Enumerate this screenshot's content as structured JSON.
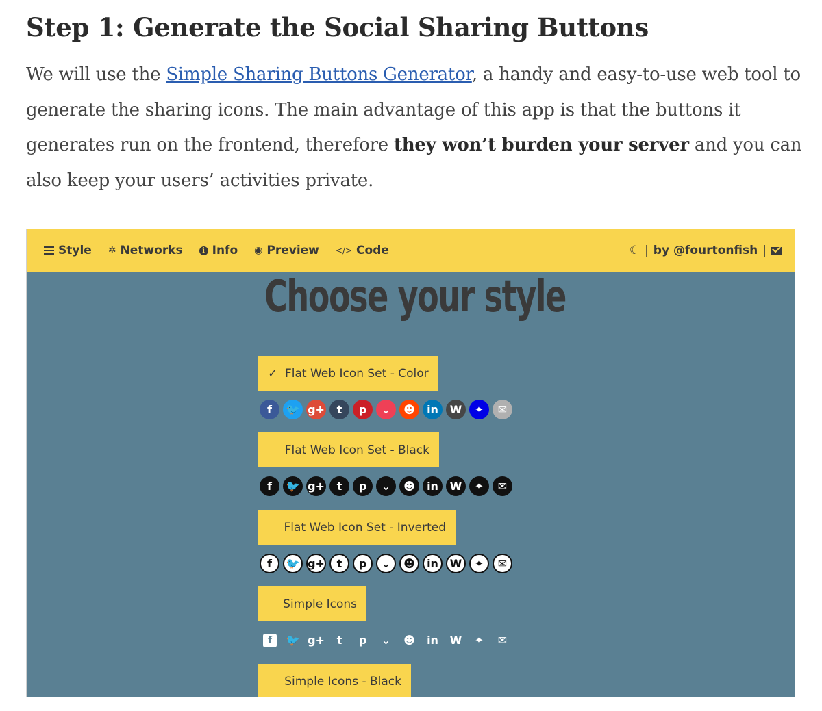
{
  "article": {
    "heading": "Step 1: Generate the Social Sharing Buttons",
    "p_before_link": "We will use the ",
    "link_text": "Simple Sharing Buttons Generator",
    "p_after_link": ", a handy and easy-to-use web tool to generate the sharing icons. The main advantage of this app is that the buttons it generates run on the frontend, therefore ",
    "p_bold": "they won’t burden your server",
    "p_end": " and you can also keep your users’ activities private."
  },
  "app": {
    "nav": [
      {
        "label": "Style",
        "icon": "list-icon"
      },
      {
        "label": "Networks",
        "icon": "gear-icon"
      },
      {
        "label": "Info",
        "icon": "info-icon"
      },
      {
        "label": "Preview",
        "icon": "eye-icon"
      },
      {
        "label": "Code",
        "icon": "code-icon"
      }
    ],
    "right_nav": {
      "moon_glyph": "☾",
      "separator": "|",
      "by_label": "by @fourtonfish",
      "icon": "mail-icon"
    },
    "title": "Choose your style",
    "style_options": [
      {
        "label": "Flat Web Icon Set - Color",
        "selected": true,
        "check": "✓"
      },
      {
        "label": "Flat Web Icon Set - Black",
        "selected": false,
        "check": ""
      },
      {
        "label": "Flat Web Icon Set - Inverted",
        "selected": false,
        "check": ""
      },
      {
        "label": "Simple Icons",
        "selected": false,
        "check": ""
      },
      {
        "label": "Simple Icons - Black",
        "selected": false,
        "check": ""
      }
    ],
    "networks": [
      {
        "name": "facebook",
        "glyph": "f",
        "color": "#3b5998"
      },
      {
        "name": "twitter",
        "glyph": "🐦",
        "color": "#1da1f2"
      },
      {
        "name": "google-plus",
        "glyph": "g+",
        "color": "#dd4b39"
      },
      {
        "name": "tumblr",
        "glyph": "t",
        "color": "#35465c"
      },
      {
        "name": "pinterest",
        "glyph": "p",
        "color": "#cb2027"
      },
      {
        "name": "pocket",
        "glyph": "⌄",
        "color": "#ef4056"
      },
      {
        "name": "reddit",
        "glyph": "☻",
        "color": "#ff4500"
      },
      {
        "name": "linkedin",
        "glyph": "in",
        "color": "#0077b5"
      },
      {
        "name": "wordpress",
        "glyph": "W",
        "color": "#464646"
      },
      {
        "name": "pinboard",
        "glyph": "✦",
        "color": "#0000e6"
      },
      {
        "name": "email",
        "glyph": "✉",
        "color": "#b0b0b0"
      }
    ]
  }
}
